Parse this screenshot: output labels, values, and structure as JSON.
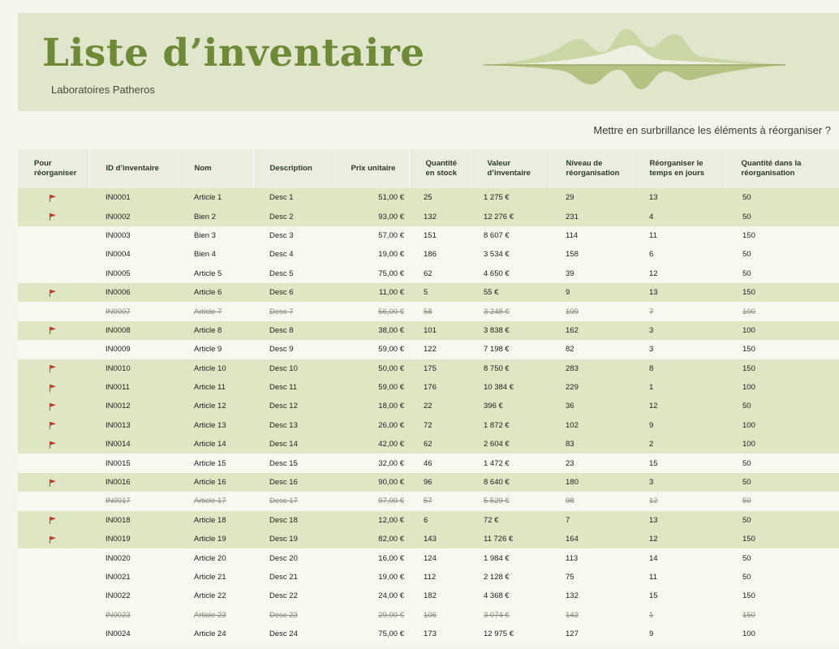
{
  "header": {
    "title": "Liste d’inventaire",
    "subtitle": "Laboratoires Patheros"
  },
  "highlight_prompt": "Mettre en surbrillance les éléments à réorganiser ?",
  "colors": {
    "accent": "#6f8a36",
    "flag": "#c0392b",
    "highlight_row": "#dfe6c4"
  },
  "table": {
    "columns": [
      "Pour réorganiser",
      "ID d’inventaire",
      "Nom",
      "Description",
      "Prix unitaire",
      "Quantité en stock",
      "Valeur d’inventaire",
      "Niveau de réorganisation",
      "Réorganiser le temps en jours",
      "Quantité dans la réorganisation"
    ],
    "rows": [
      {
        "flag": true,
        "discontinued": false,
        "id": "IN0001",
        "name": "Article 1",
        "desc": "Desc 1",
        "price": "51,00 €",
        "qty": "25",
        "value": "1 275 €",
        "level": "29",
        "days": "13",
        "reorder_qty": "50"
      },
      {
        "flag": true,
        "discontinued": false,
        "id": "IN0002",
        "name": "Bien 2",
        "desc": "Desc 2",
        "price": "93,00 €",
        "qty": "132",
        "value": "12 276 €",
        "level": "231",
        "days": "4",
        "reorder_qty": "50"
      },
      {
        "flag": false,
        "discontinued": false,
        "id": "IN0003",
        "name": "Bien 3",
        "desc": "Desc 3",
        "price": "57,00 €",
        "qty": "151",
        "value": "8 607 €",
        "level": "114",
        "days": "11",
        "reorder_qty": "150"
      },
      {
        "flag": false,
        "discontinued": false,
        "id": "IN0004",
        "name": "Bien 4",
        "desc": "Desc 4",
        "price": "19,00 €",
        "qty": "186",
        "value": "3 534 €",
        "level": "158",
        "days": "6",
        "reorder_qty": "50"
      },
      {
        "flag": false,
        "discontinued": false,
        "id": "IN0005",
        "name": "Article 5",
        "desc": "Desc 5",
        "price": "75,00 €",
        "qty": "62",
        "value": "4 650 €",
        "level": "39",
        "days": "12",
        "reorder_qty": "50"
      },
      {
        "flag": true,
        "discontinued": false,
        "id": "IN0006",
        "name": "Article 6",
        "desc": "Desc 6",
        "price": "11,00 €",
        "qty": "5",
        "value": "55 €",
        "level": "9",
        "days": "13",
        "reorder_qty": "150"
      },
      {
        "flag": false,
        "discontinued": true,
        "id": "IN0007",
        "name": "Article 7",
        "desc": "Desc 7",
        "price": "56,00 €",
        "qty": "58",
        "value": "3 248 €",
        "level": "109",
        "days": "7",
        "reorder_qty": "100"
      },
      {
        "flag": true,
        "discontinued": false,
        "id": "IN0008",
        "name": "Article 8",
        "desc": "Desc 8",
        "price": "38,00 €",
        "qty": "101",
        "value": "3 838 €",
        "level": "162",
        "days": "3",
        "reorder_qty": "100"
      },
      {
        "flag": false,
        "discontinued": false,
        "id": "IN0009",
        "name": "Article 9",
        "desc": "Desc 9",
        "price": "59,00 €",
        "qty": "122",
        "value": "7 198 €",
        "level": "82",
        "days": "3",
        "reorder_qty": "150"
      },
      {
        "flag": true,
        "discontinued": false,
        "id": "IN0010",
        "name": "Article 10",
        "desc": "Desc 10",
        "price": "50,00 €",
        "qty": "175",
        "value": "8 750 €",
        "level": "283",
        "days": "8",
        "reorder_qty": "150"
      },
      {
        "flag": true,
        "discontinued": false,
        "id": "IN0011",
        "name": "Article 11",
        "desc": "Desc 11",
        "price": "59,00 €",
        "qty": "176",
        "value": "10 384 €",
        "level": "229",
        "days": "1",
        "reorder_qty": "100"
      },
      {
        "flag": true,
        "discontinued": false,
        "id": "IN0012",
        "name": "Article 12",
        "desc": "Desc 12",
        "price": "18,00 €",
        "qty": "22",
        "value": "396 €",
        "level": "36",
        "days": "12",
        "reorder_qty": "50"
      },
      {
        "flag": true,
        "discontinued": false,
        "id": "IN0013",
        "name": "Article 13",
        "desc": "Desc 13",
        "price": "26,00 €",
        "qty": "72",
        "value": "1 872 €",
        "level": "102",
        "days": "9",
        "reorder_qty": "100"
      },
      {
        "flag": true,
        "discontinued": false,
        "id": "IN0014",
        "name": "Article 14",
        "desc": "Desc 14",
        "price": "42,00 €",
        "qty": "62",
        "value": "2 604 €",
        "level": "83",
        "days": "2",
        "reorder_qty": "100"
      },
      {
        "flag": false,
        "discontinued": false,
        "id": "IN0015",
        "name": "Article 15",
        "desc": "Desc 15",
        "price": "32,00 €",
        "qty": "46",
        "value": "1 472 €",
        "level": "23",
        "days": "15",
        "reorder_qty": "50"
      },
      {
        "flag": true,
        "discontinued": false,
        "id": "IN0016",
        "name": "Article 16",
        "desc": "Desc 16",
        "price": "90,00 €",
        "qty": "96",
        "value": "8 640 €",
        "level": "180",
        "days": "3",
        "reorder_qty": "50"
      },
      {
        "flag": false,
        "discontinued": true,
        "id": "IN0017",
        "name": "Article 17",
        "desc": "Desc 17",
        "price": "97,00 €",
        "qty": "57",
        "value": "5 529 €",
        "level": "98",
        "days": "12",
        "reorder_qty": "50"
      },
      {
        "flag": true,
        "discontinued": false,
        "id": "IN0018",
        "name": "Article 18",
        "desc": "Desc 18",
        "price": "12,00 €",
        "qty": "6",
        "value": "72 €",
        "level": "7",
        "days": "13",
        "reorder_qty": "50"
      },
      {
        "flag": true,
        "discontinued": false,
        "id": "IN0019",
        "name": "Article 19",
        "desc": "Desc 19",
        "price": "82,00 €",
        "qty": "143",
        "value": "11 726 €",
        "level": "164",
        "days": "12",
        "reorder_qty": "150"
      },
      {
        "flag": false,
        "discontinued": false,
        "id": "IN0020",
        "name": "Article 20",
        "desc": "Desc 20",
        "price": "16,00 €",
        "qty": "124",
        "value": "1 984 €",
        "level": "113",
        "days": "14",
        "reorder_qty": "50"
      },
      {
        "flag": false,
        "discontinued": false,
        "id": "IN0021",
        "name": "Article 21",
        "desc": "Desc 21",
        "price": "19,00 €",
        "qty": "112",
        "value": "2 128 €",
        "level": "75",
        "days": "11",
        "reorder_qty": "50"
      },
      {
        "flag": false,
        "discontinued": false,
        "id": "IN0022",
        "name": "Article 22",
        "desc": "Desc 22",
        "price": "24,00 €",
        "qty": "182",
        "value": "4 368 €",
        "level": "132",
        "days": "15",
        "reorder_qty": "150"
      },
      {
        "flag": false,
        "discontinued": true,
        "id": "IN0023",
        "name": "Article 23",
        "desc": "Desc 23",
        "price": "29,00 €",
        "qty": "106",
        "value": "3 074 €",
        "level": "142",
        "days": "1",
        "reorder_qty": "150"
      },
      {
        "flag": false,
        "discontinued": false,
        "id": "IN0024",
        "name": "Article 24",
        "desc": "Desc 24",
        "price": "75,00 €",
        "qty": "173",
        "value": "12 975 €",
        "level": "127",
        "days": "9",
        "reorder_qty": "100"
      }
    ]
  }
}
